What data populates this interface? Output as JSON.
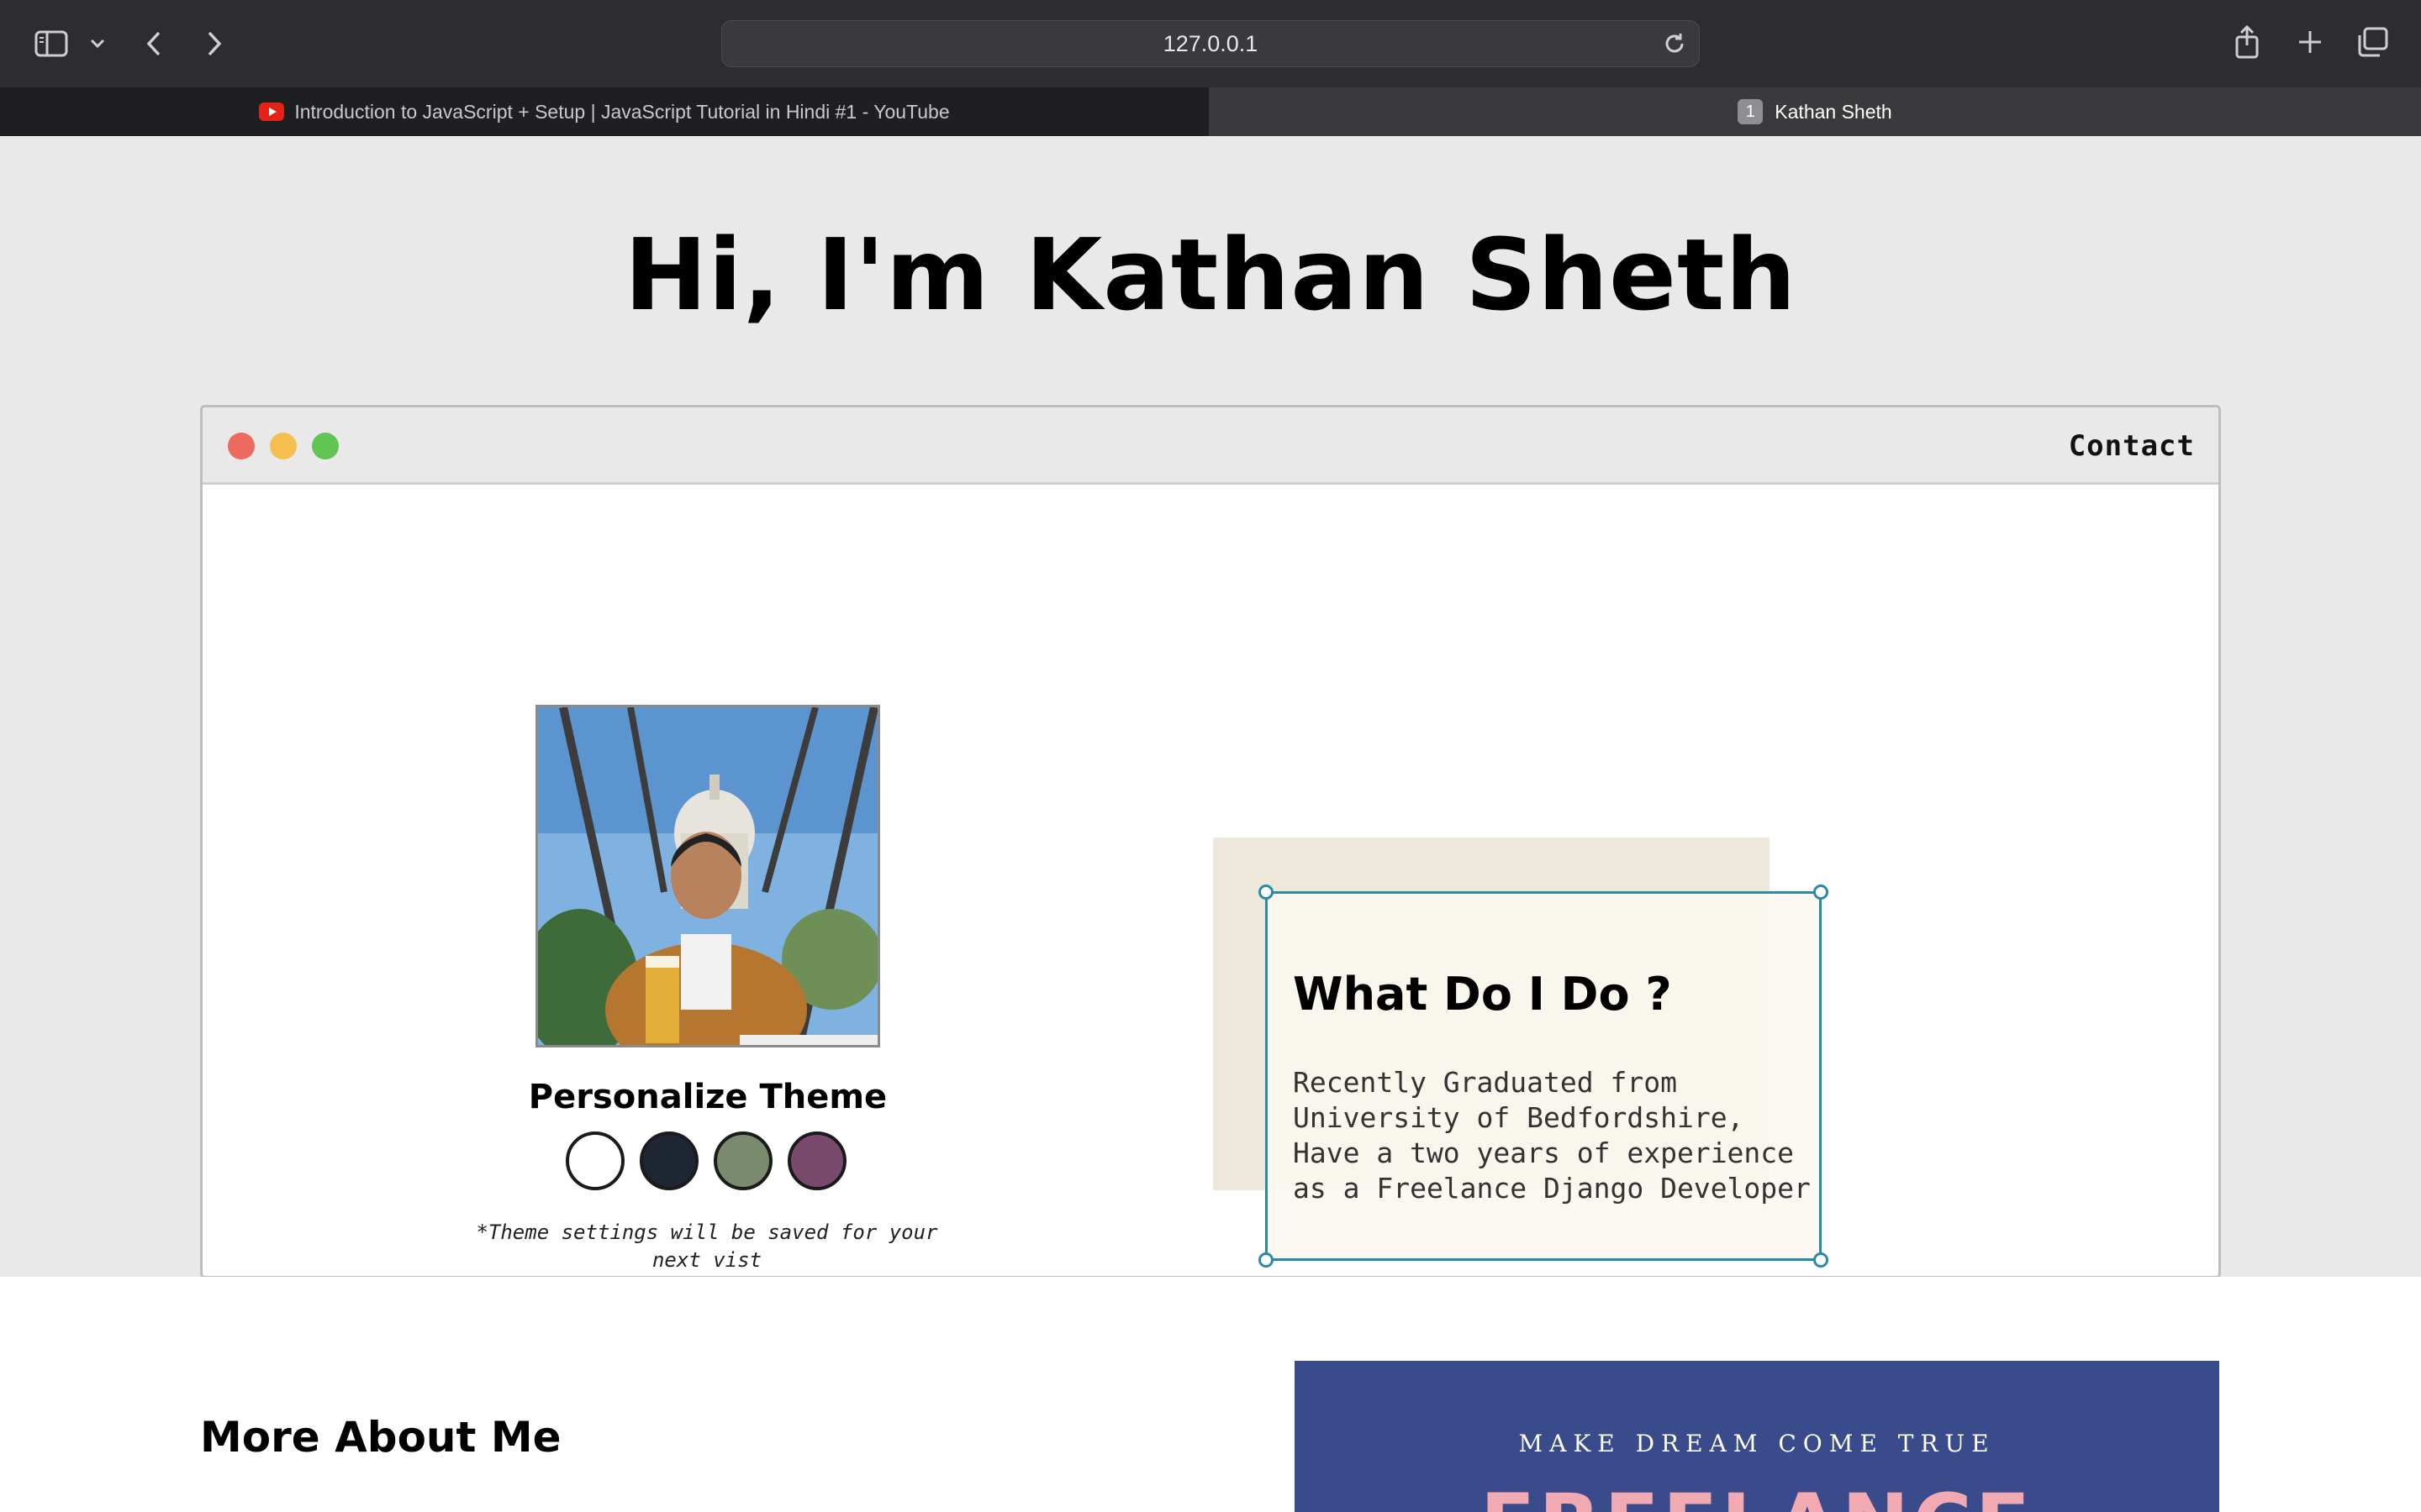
{
  "browser": {
    "url": "127.0.0.1",
    "tabs": [
      {
        "label": "Introduction to JavaScript + Setup | JavaScript Tutorial in Hindi #1 - YouTube",
        "icon": "youtube-icon",
        "active": false
      },
      {
        "label": "Kathan Sheth",
        "badge": "1",
        "active": true
      }
    ]
  },
  "hero": {
    "title": "Hi, I'm Kathan Sheth"
  },
  "window": {
    "nav": {
      "contact_label": "Contact"
    },
    "theme": {
      "title": "Personalize Theme",
      "swatches": [
        "#ffffff",
        "#1e2533",
        "#7a8a6c",
        "#7a4a6e"
      ],
      "note": "*Theme settings will be saved for your next vist"
    },
    "about": {
      "title": "What Do I Do ?",
      "text": "Recently Graduated from University of Bedfordshire, Have a two years of experience as a Freelance Django Developer"
    }
  },
  "more": {
    "title": "More About Me",
    "banner_tagline": "MAKE DREAM COME TRUE",
    "banner_heading": "FREELANCE"
  }
}
